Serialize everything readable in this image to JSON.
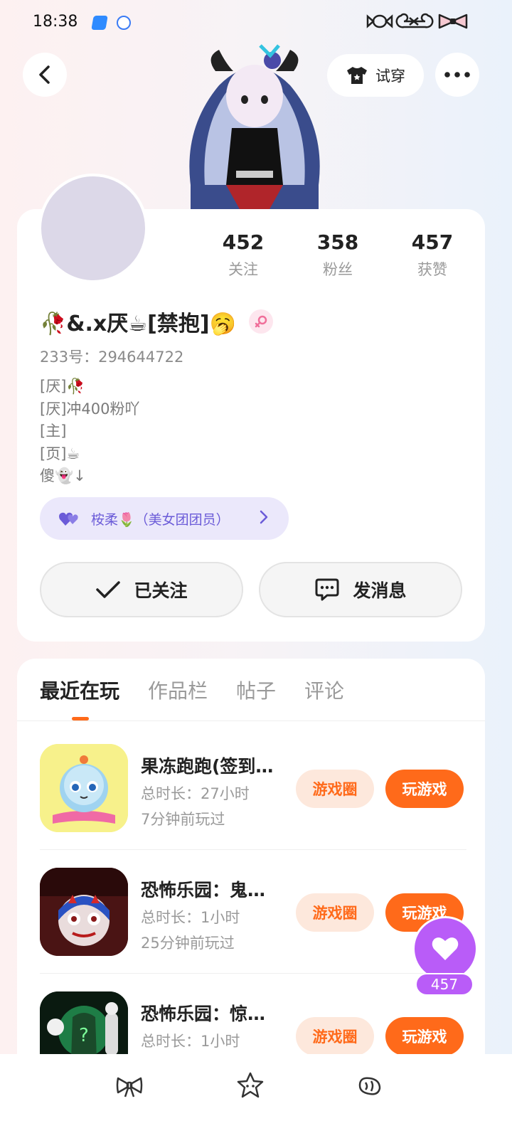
{
  "status_bar": {
    "time": "18:38"
  },
  "header": {
    "tryon_label": "试穿"
  },
  "profile": {
    "stats": [
      {
        "value": "452",
        "label": "关注"
      },
      {
        "value": "358",
        "label": "粉丝"
      },
      {
        "value": "457",
        "label": "获赞"
      }
    ],
    "name": "🥀&.x厌☕[禁抱]🥱",
    "uid": "233号：294644722",
    "bio_lines": [
      "[厌]🥀",
      "[厌]冲400粉吖",
      "[主]",
      "[页]☕",
      "傻👻↓"
    ],
    "team_badge": "桉柔🌷（美女团团员）",
    "follow_button": "已关注",
    "message_button": "发消息"
  },
  "tabs": [
    "最近在玩",
    "作品栏",
    "帖子",
    "评论"
  ],
  "games": [
    {
      "title": "果冻跑跑(签到…",
      "duration": "总时长：27小时",
      "last_played": "7分钟前玩过",
      "circle_label": "游戏圈",
      "play_label": "玩游戏"
    },
    {
      "title": "恐怖乐园：鬼…",
      "duration": "总时长：1小时",
      "last_played": "25分钟前玩过",
      "circle_label": "游戏圈",
      "play_label": "玩游戏"
    },
    {
      "title": "恐怖乐园：惊…",
      "duration": "总时长：1小时",
      "last_played": "",
      "circle_label": "游戏圈",
      "play_label": "玩游戏"
    }
  ],
  "like_fab": {
    "count": "457"
  },
  "colors": {
    "accent": "#ff6a1a",
    "like": "#b95cf8",
    "team": "#6b5bd8"
  }
}
